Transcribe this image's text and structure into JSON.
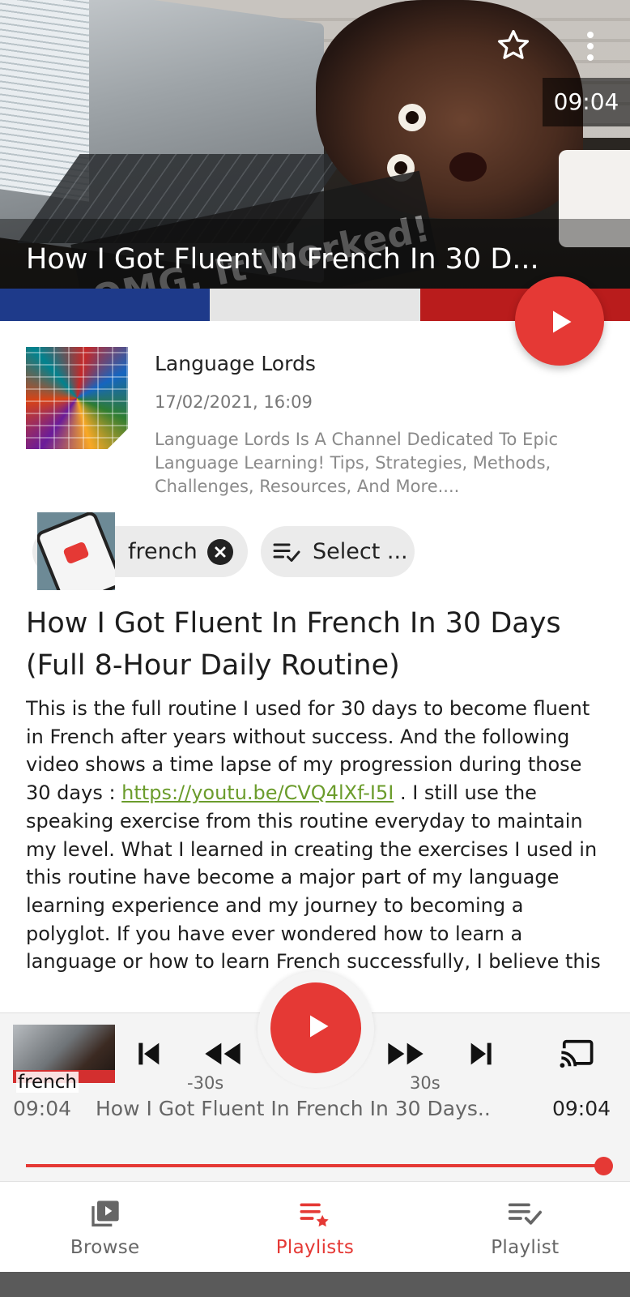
{
  "hero": {
    "title": "How I Got Fluent In French In 30 D...",
    "duration": "09:04",
    "thumbnail_overlay_text": "OMG, It Worked!",
    "flag_colors": [
      "#1e3a8a",
      "#e5e5e5",
      "#b91c1c"
    ]
  },
  "channel": {
    "name": "Language Lords",
    "date": "17/02/2021, 16:09",
    "description": "Language Lords Is A Channel Dedicated To Epic Language Learning! Tips, Strategies, Methods, Challenges, Resources, And More...."
  },
  "chips": {
    "tag_label": "french",
    "select_label": "Select ..."
  },
  "video": {
    "title": "How I Got Fluent In French In 30 Days (Full 8-Hour Daily Routine)",
    "desc_part1": "This is the full routine I used for 30 days to become fluent in French after years without success. And the following video shows a time lapse of my progression during those 30 days : ",
    "link": "https://youtu.be/CVQ4lXf-I5I",
    "desc_part2": " . I still use the speaking exercise from this routine everyday to maintain my level. What I learned in creating the exercises I used in this routine have become a major part of my language learning experience and my journey to becoming a polyglot. If you have ever wondered how to learn a language or how to learn French successfully, I believe this"
  },
  "player": {
    "thumb_label": "french",
    "rewind_label": "-30s",
    "forward_label": "30s",
    "time_elapsed": "09:04",
    "now_playing": "How I Got Fluent In French In 30 Days..",
    "time_total": "09:04",
    "progress_fraction": 1.0
  },
  "nav": {
    "items": [
      {
        "label": "Browse",
        "icon": "browse-icon",
        "active": false
      },
      {
        "label": "Playlists",
        "icon": "playlists-star-icon",
        "active": true
      },
      {
        "label": "Playlist",
        "icon": "playlist-check-icon",
        "active": false
      }
    ]
  },
  "colors": {
    "accent": "#e53935",
    "link": "#6b9c2c"
  }
}
